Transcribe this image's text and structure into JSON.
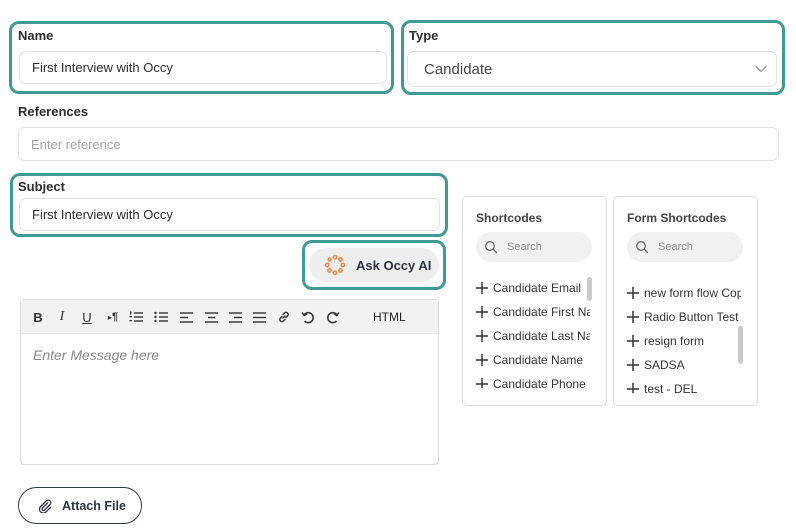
{
  "name": {
    "label": "Name",
    "value": "First Interview with Occy"
  },
  "type": {
    "label": "Type",
    "selected": "Candidate"
  },
  "references": {
    "label": "References",
    "placeholder": "Enter reference"
  },
  "subject": {
    "label": "Subject",
    "value": "First Interview with Occy"
  },
  "ask_ai": {
    "label": "Ask Occy AI"
  },
  "editor": {
    "toolbar": {
      "bold": "B",
      "italic": "I",
      "underline": "U",
      "paragraph": "¶",
      "html": "HTML"
    },
    "placeholder": "Enter Message here"
  },
  "shortcodes": {
    "title": "Shortcodes",
    "search_placeholder": "Search",
    "items": [
      "Candidate Email",
      "Candidate First Na",
      "Candidate Last Na",
      "Candidate Name",
      "Candidate Phone"
    ]
  },
  "form_shortcodes": {
    "title": "Form Shortcodes",
    "search_placeholder": "Search",
    "items": [
      "new form flow Cop",
      "Radio Button Test",
      "resign form",
      "SADSA",
      "test - DEL"
    ]
  },
  "attach": {
    "label": "Attach File"
  },
  "colors": {
    "highlight": "#3f9a94",
    "ai_icon": "#e8874a",
    "button_border": "#333a46"
  }
}
